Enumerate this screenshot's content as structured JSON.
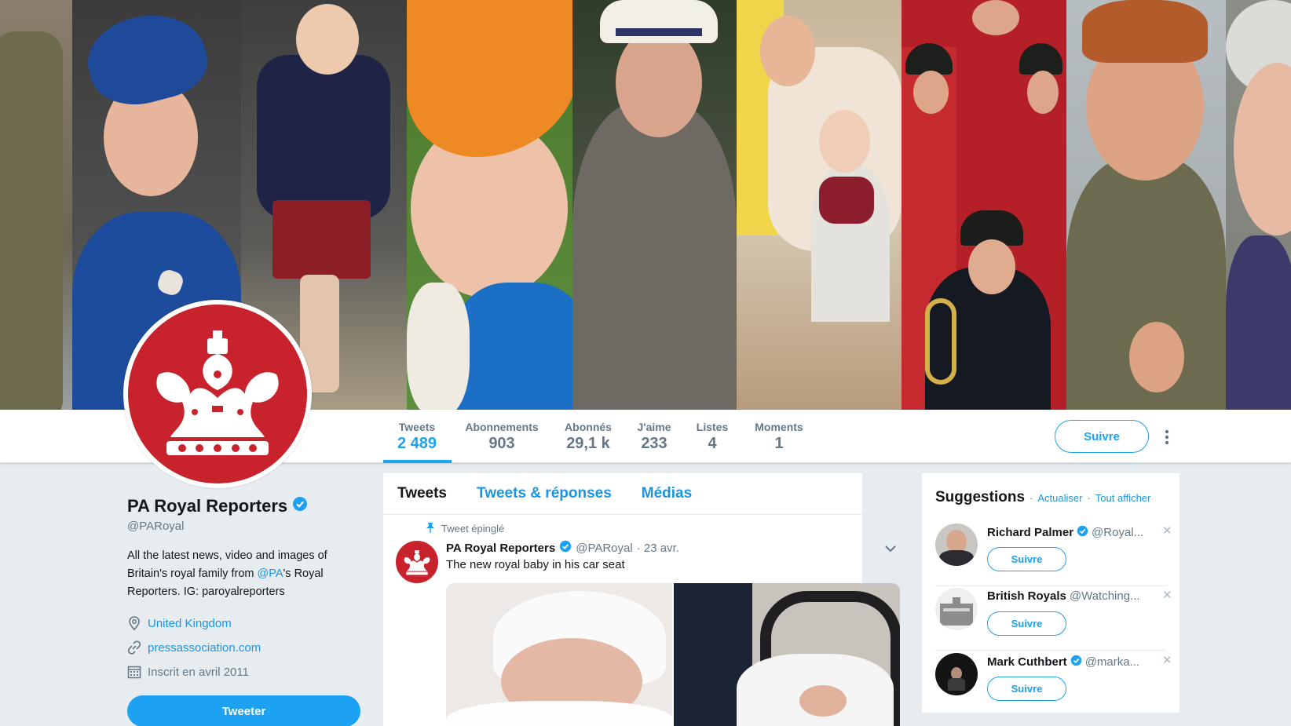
{
  "profile": {
    "name": "PA Royal Reporters",
    "handle": "@PARoyal",
    "bio_part1": "All the latest news, video and images of Britain's royal family from ",
    "bio_link": "@PA",
    "bio_part2": "'s Royal Reporters. IG: paroyalreporters",
    "location": "United Kingdom",
    "website": "pressassociation.com",
    "joined": "Inscrit en avril 2011",
    "tweet_button": "Tweeter"
  },
  "nav": {
    "stats": [
      {
        "label": "Tweets",
        "value": "2 489"
      },
      {
        "label": "Abonnements",
        "value": "903"
      },
      {
        "label": "Abonnés",
        "value": "29,1 k"
      },
      {
        "label": "J'aime",
        "value": "233"
      },
      {
        "label": "Listes",
        "value": "4"
      },
      {
        "label": "Moments",
        "value": "1"
      }
    ],
    "follow_button": "Suivre"
  },
  "timeline": {
    "tabs": [
      "Tweets",
      "Tweets & réponses",
      "Médias"
    ],
    "pinned_label": "Tweet épinglé",
    "tweet": {
      "name": "PA Royal Reporters",
      "handle": "@PARoyal",
      "date": "· 23 avr.",
      "text": "The new royal baby in his car seat"
    }
  },
  "suggestions": {
    "title": "Suggestions",
    "refresh": "Actualiser",
    "separator": "·",
    "view_all": "Tout afficher",
    "items": [
      {
        "name": "Richard Palmer",
        "handle": "@Royal...",
        "button": "Suivre"
      },
      {
        "name": "British Royals",
        "handle": "@Watching...",
        "button": "Suivre"
      },
      {
        "name": "Mark Cuthbert",
        "handle": "@marka...",
        "button": "Suivre"
      }
    ]
  },
  "colors": {
    "accent": "#1da1f2",
    "brand_red": "#c8232c",
    "background": "#e6ecf0"
  },
  "icons": {
    "verified": "verified-badge-icon",
    "location": "location-pin-icon",
    "link": "link-icon",
    "calendar": "calendar-icon",
    "pin": "pin-icon",
    "chevron": "chevron-down-icon",
    "close": "close-icon",
    "more": "more-vertical-icon"
  }
}
